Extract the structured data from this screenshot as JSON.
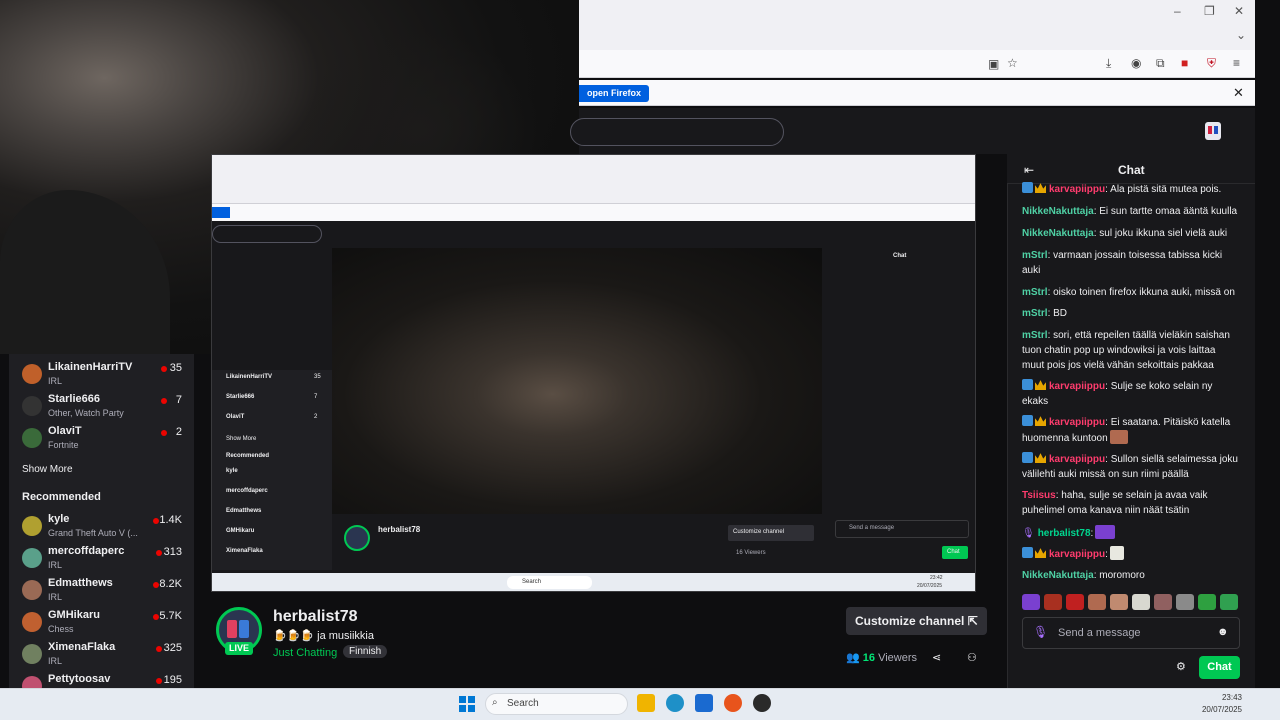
{
  "browser": {
    "open_firefox_label": "open Firefox",
    "window_controls": [
      "–",
      "❐",
      "✕"
    ]
  },
  "sidebar": {
    "channels": [
      {
        "name": "LikainenHarriTV",
        "game": "IRL",
        "viewers": "35",
        "avatar_color": "#c0602a"
      },
      {
        "name": "Starlie666",
        "game": "Other, Watch Party",
        "viewers": "7",
        "avatar_color": "#333333"
      },
      {
        "name": "OlaviT",
        "game": "Fortnite",
        "viewers": "2",
        "avatar_color": "#3a6a3a"
      }
    ],
    "show_more": "Show More",
    "recommended_heading": "Recommended",
    "recommended": [
      {
        "name": "kyle",
        "game": "Grand Theft Auto V (...",
        "viewers": "1.4K",
        "avatar_color": "#b0a030"
      },
      {
        "name": "mercoffdaperc",
        "game": "IRL",
        "viewers": "313",
        "avatar_color": "#5aa08a"
      },
      {
        "name": "Edmatthews",
        "game": "IRL",
        "viewers": "8.2K",
        "avatar_color": "#9a6a55"
      },
      {
        "name": "GMHikaru",
        "game": "Chess",
        "viewers": "5.7K",
        "avatar_color": "#c06030"
      },
      {
        "name": "XimenaFlaka",
        "game": "IRL",
        "viewers": "325",
        "avatar_color": "#708060"
      },
      {
        "name": "Pettytoosav",
        "game": "",
        "viewers": "195",
        "avatar_color": "#c05070"
      }
    ]
  },
  "channel": {
    "name": "herbalist78",
    "subtitle": "🍺🍺🍺 ja musiikkia",
    "category": "Just Chatting",
    "tag": "Finnish",
    "live_label": "LIVE",
    "customize_label": "Customize channel",
    "viewers_count": "16",
    "viewers_label": "Viewers"
  },
  "chat": {
    "title": "Chat",
    "messages": [
      {
        "user": "karvapiippu",
        "text": ": Ala pistä sitä mutea pois.",
        "badges": true,
        "color": "red"
      },
      {
        "user": "NikkeNakuttaja",
        "text": ": Ei sun tartte omaa ääntä kuulla",
        "badges": false,
        "color": "nikke"
      },
      {
        "user": "NikkeNakuttaja",
        "text": ": sul joku ikkuna siel vielä auki",
        "badges": false,
        "color": "nikke"
      },
      {
        "user": "mStrl",
        "text": ": varmaan jossain toisessa tabissa kicki auki",
        "badges": false,
        "color": "mstrl"
      },
      {
        "user": "mStrl",
        "text": ": oisko toinen firefox ikkuna auki, missä on",
        "badges": false,
        "color": "mstrl"
      },
      {
        "user": "mStrl",
        "text": ": BD",
        "badges": false,
        "color": "mstrl"
      },
      {
        "user": "mStrl",
        "text": ": sori, että repeilen täällä vieläkin saishan tuon chatin pop up windowiksi ja vois laittaa muut pois jos vielä vähän sekoittais pakkaa",
        "badges": false,
        "color": "mstrl"
      },
      {
        "user": "karvapiippu",
        "text": ": Sulje se koko selain ny ekaks",
        "badges": true,
        "color": "red"
      },
      {
        "user": "karvapiippu",
        "text": ": Ei saatana. Pitäiskö katella huomenna kuntoon",
        "badges": true,
        "color": "red"
      },
      {
        "user": "karvapiippu",
        "text": ": Sullon siellä selaimessa joku välilehti auki missä on sun riimi päällä",
        "badges": true,
        "color": "red"
      },
      {
        "user": "Tsiisus",
        "text": ": haha, sulje se selain ja avaa vaik puhelimel oma kanava niin näät tsätin",
        "badges": false,
        "color": "tsii"
      },
      {
        "user": "herbalist78",
        "text": ":",
        "badges": false,
        "color": "herb"
      },
      {
        "user": "karvapiippu",
        "text": ":",
        "badges": true,
        "color": "red"
      },
      {
        "user": "NikkeNakuttaja",
        "text": ": moromoro",
        "badges": false,
        "color": "nikke"
      }
    ],
    "input_placeholder": "Send a message",
    "send_label": "Chat"
  },
  "nested": {
    "chat_title": "Chat",
    "channel_name": "herbalist78",
    "customize_label": "Customize channel",
    "viewers": "16 Viewers",
    "send_placeholder": "Send a message",
    "chat_label": "Chat",
    "show_more": "Show More",
    "recommended": "Recommended",
    "time": "23:42",
    "date": "20/07/2025",
    "search": "Search"
  },
  "taskbar": {
    "search_label": "Search",
    "time": "23:43",
    "date": "20/07/2025"
  }
}
